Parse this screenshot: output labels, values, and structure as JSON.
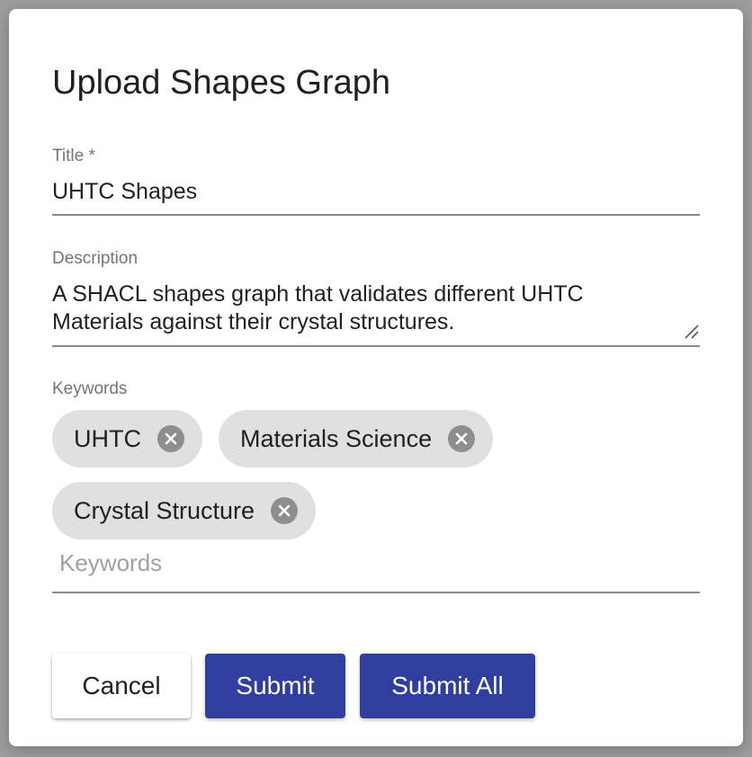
{
  "dialog": {
    "title": "Upload Shapes Graph"
  },
  "title_field": {
    "label": "Title *",
    "value": "UHTC Shapes"
  },
  "description_field": {
    "label": "Description",
    "line1": "A SHACL shapes graph that validates different UHTC",
    "line2": "Materials against their crystal structures."
  },
  "keywords_field": {
    "label": "Keywords",
    "placeholder": "Keywords",
    "chips": [
      {
        "label": "UHTC",
        "delete_icon": "cancel-circle-icon"
      },
      {
        "label": "Materials Science",
        "delete_icon": "cancel-circle-icon"
      },
      {
        "label": "Crystal Structure",
        "delete_icon": "cancel-circle-icon"
      }
    ]
  },
  "actions": {
    "cancel_label": "Cancel",
    "submit_label": "Submit",
    "submit_all_label": "Submit All"
  },
  "colors": {
    "primary": "#303f9f",
    "chip_background": "#e0e0e0",
    "chip_delete_icon": "#8e8e8e",
    "label_text": "#757575",
    "backdrop": "#9e9e9e"
  }
}
